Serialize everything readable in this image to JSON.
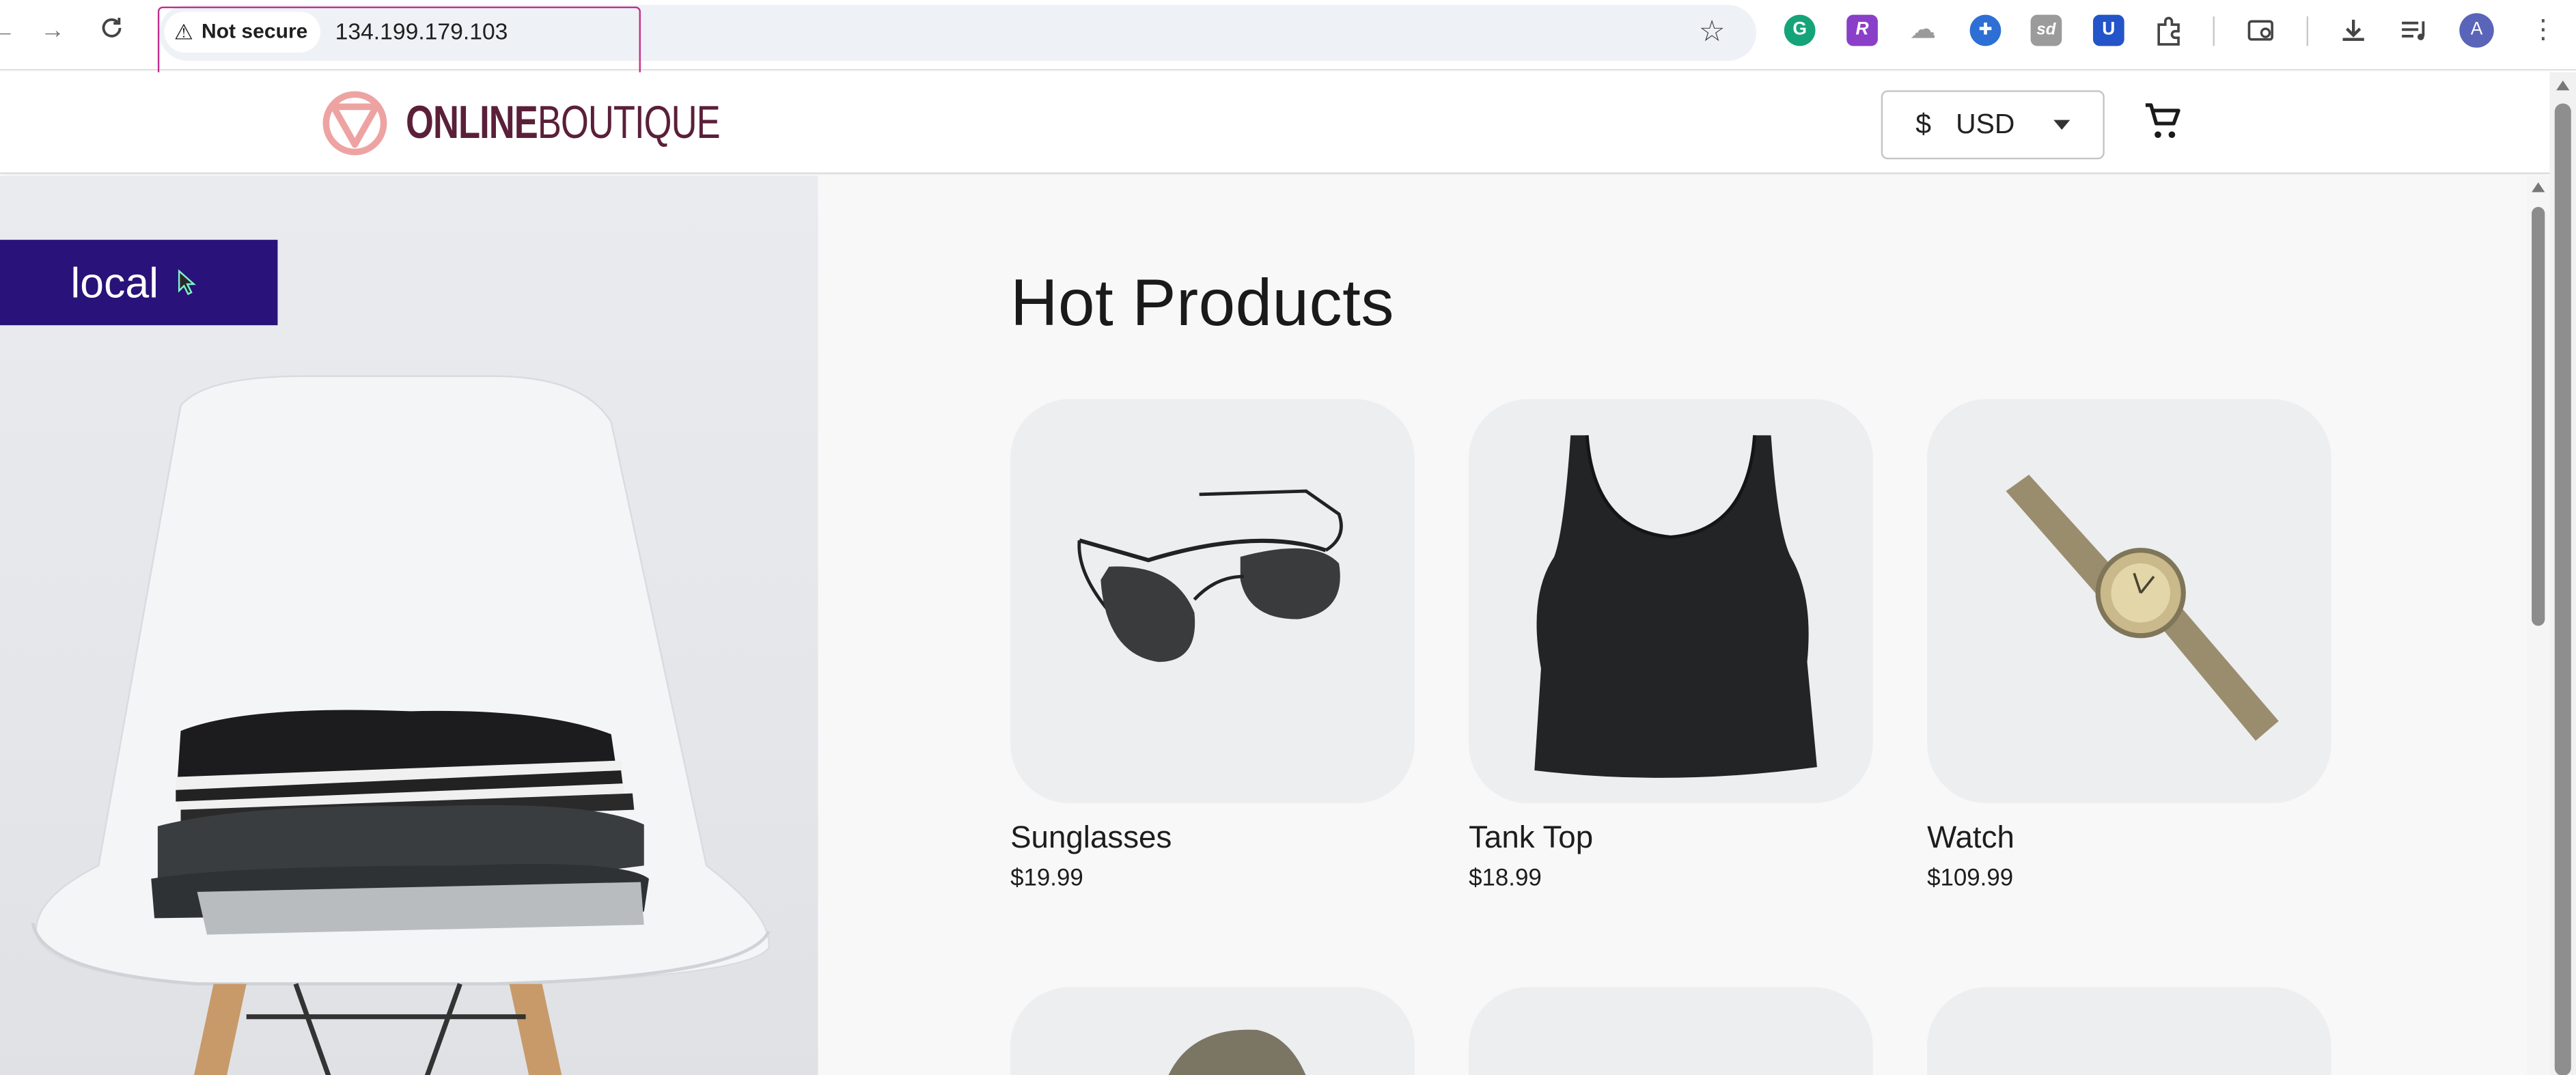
{
  "browser": {
    "security_label": "Not secure",
    "url": "134.199.179.103",
    "profile_initial": "A",
    "extensions": [
      {
        "name": "grammarly-icon",
        "glyph": "G",
        "color": "#15a37a"
      },
      {
        "name": "extension-r-icon",
        "glyph": "R",
        "color": "#8a3fc9"
      },
      {
        "name": "extension-cloud-icon",
        "glyph": "☁",
        "color": "#9a9a9a"
      },
      {
        "name": "extension-blue-icon",
        "glyph": "✚",
        "color": "#2d6fd4"
      },
      {
        "name": "extension-sd-icon",
        "glyph": "sd",
        "color": "#9b9b9b"
      },
      {
        "name": "bitwarden-icon",
        "glyph": "U",
        "color": "#2354c9"
      }
    ]
  },
  "header": {
    "logo_bold": "ONLINE",
    "logo_light": "BOUTIQUE",
    "currency_symbol": "$",
    "currency_code": "USD"
  },
  "hero": {
    "env_label": "local"
  },
  "products_section": {
    "title": "Hot Products",
    "items": [
      {
        "name": "Sunglasses",
        "price": "$19.99",
        "image": "sunglasses"
      },
      {
        "name": "Tank Top",
        "price": "$18.99",
        "image": "tank-top"
      },
      {
        "name": "Watch",
        "price": "$109.99",
        "image": "watch"
      }
    ]
  },
  "colors": {
    "brand": "#5b1f39",
    "logo_accent": "#eea3a3",
    "env_badge": "#291279",
    "url_focus": "#c2308f"
  }
}
